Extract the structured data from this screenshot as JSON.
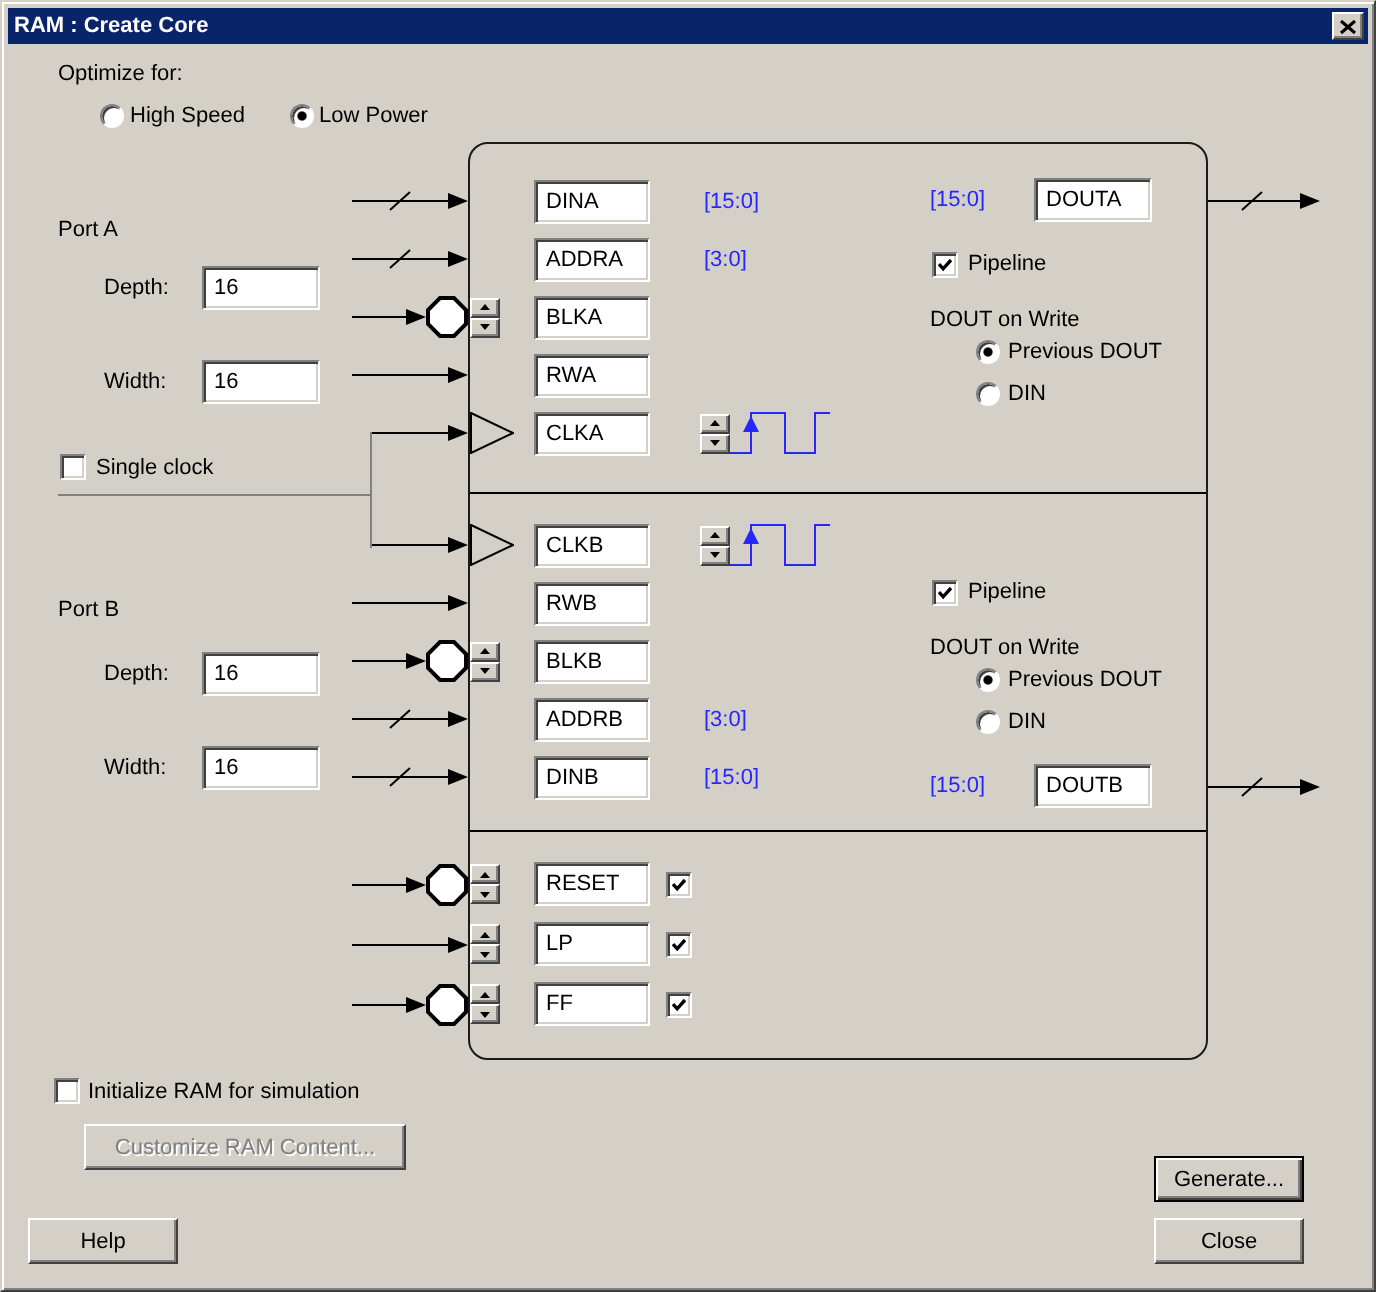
{
  "window": {
    "title": "RAM : Create Core"
  },
  "optimize": {
    "label": "Optimize for:",
    "options": [
      {
        "label": "High Speed",
        "selected": false
      },
      {
        "label": "Low Power",
        "selected": true
      }
    ]
  },
  "ports": [
    {
      "label": "Port A",
      "depth": {
        "label": "Depth:",
        "value": "16"
      },
      "width": {
        "label": "Width:",
        "value": "16"
      },
      "inputs": [
        {
          "kind": "bus",
          "name": "DINA",
          "range": "[15:0]"
        },
        {
          "kind": "bus",
          "name": "ADDRA",
          "range": "[3:0]"
        },
        {
          "kind": "polarity",
          "name": "BLKA",
          "inverted": true
        },
        {
          "kind": "signal",
          "name": "RWA"
        },
        {
          "kind": "clock",
          "name": "CLKA",
          "rising_edge": true
        }
      ],
      "settings": [
        {
          "kind": "output",
          "range": "[15:0]",
          "name": "DOUTA"
        },
        {
          "kind": "checkbox",
          "label": "Pipeline",
          "checked": true
        },
        {
          "kind": "radio_group",
          "label": "DOUT on Write",
          "options": [
            {
              "label": "Previous DOUT",
              "selected": true
            },
            {
              "label": "DIN",
              "selected": false
            }
          ]
        }
      ]
    },
    {
      "label": "Port B",
      "depth": {
        "label": "Depth:",
        "value": "16"
      },
      "width": {
        "label": "Width:",
        "value": "16"
      },
      "inputs": [
        {
          "kind": "clock",
          "name": "CLKB",
          "rising_edge": true
        },
        {
          "kind": "signal",
          "name": "RWB"
        },
        {
          "kind": "polarity",
          "name": "BLKB",
          "inverted": true
        },
        {
          "kind": "bus",
          "name": "ADDRB",
          "range": "[3:0]"
        },
        {
          "kind": "bus",
          "name": "DINB",
          "range": "[15:0]"
        }
      ],
      "settings": [
        {
          "kind": "checkbox",
          "label": "Pipeline",
          "checked": true
        },
        {
          "kind": "radio_group",
          "label": "DOUT on Write",
          "options": [
            {
              "label": "Previous DOUT",
              "selected": true
            },
            {
              "label": "DIN",
              "selected": false
            }
          ]
        },
        {
          "kind": "output",
          "range": "[15:0]",
          "name": "DOUTB"
        }
      ]
    }
  ],
  "single_clock": {
    "label": "Single clock",
    "checked": false
  },
  "controls": [
    {
      "kind": "polarity",
      "name": "RESET",
      "inverted": true,
      "checked": true
    },
    {
      "kind": "polarity",
      "name": "LP",
      "inverted": false,
      "checked": true
    },
    {
      "kind": "polarity",
      "name": "FF",
      "inverted": true,
      "checked": true
    }
  ],
  "initialize": {
    "label": "Initialize RAM for simulation",
    "checked": false
  },
  "customize_button": {
    "label": "Customize RAM Content...",
    "disabled": true
  },
  "buttons": [
    {
      "label": "Generate...",
      "default": true
    },
    {
      "label": "Close",
      "default": false
    }
  ],
  "help_button": {
    "label": "Help"
  }
}
